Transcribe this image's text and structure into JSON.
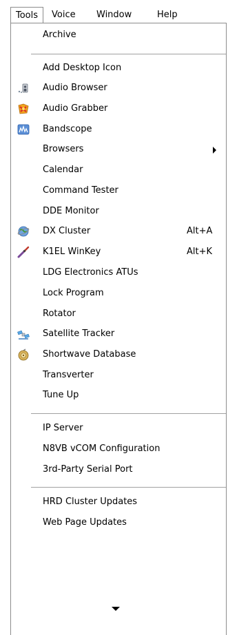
{
  "menubar": {
    "items": [
      {
        "label": "Tools"
      },
      {
        "label": "Voice"
      },
      {
        "label": "Window"
      },
      {
        "label": "Help"
      }
    ]
  },
  "menu": {
    "archive": "Archive",
    "add_desktop_icon": "Add Desktop Icon",
    "audio_browser": "Audio Browser",
    "audio_grabber": "Audio Grabber",
    "bandscope": "Bandscope",
    "browsers": "Browsers",
    "calendar": "Calendar",
    "command_tester": "Command Tester",
    "dde_monitor": "DDE Monitor",
    "dx_cluster": "DX Cluster",
    "dx_cluster_accel": "Alt+A",
    "k1el_winkey": "K1EL WinKey",
    "k1el_winkey_accel": "Alt+K",
    "ldg_atus": "LDG Electronics ATUs",
    "lock_program": "Lock Program",
    "rotator": "Rotator",
    "satellite_tracker": "Satellite Tracker",
    "shortwave_database": "Shortwave Database",
    "transverter": "Transverter",
    "tune_up": "Tune Up",
    "ip_server": "IP Server",
    "n8vb_vcom": "N8VB vCOM Configuration",
    "third_party_serial": "3rd-Party Serial Port",
    "hrd_cluster_updates": "HRD Cluster Updates",
    "web_page_updates": "Web Page Updates"
  },
  "icons": {
    "audio_browser": "speaker-icon",
    "audio_grabber": "grabber-icon",
    "bandscope": "spectrum-icon",
    "dx_cluster": "globe-icon",
    "k1el_winkey": "key-paddle-icon",
    "satellite_tracker": "satellite-icon",
    "shortwave_database": "radio-icon"
  }
}
